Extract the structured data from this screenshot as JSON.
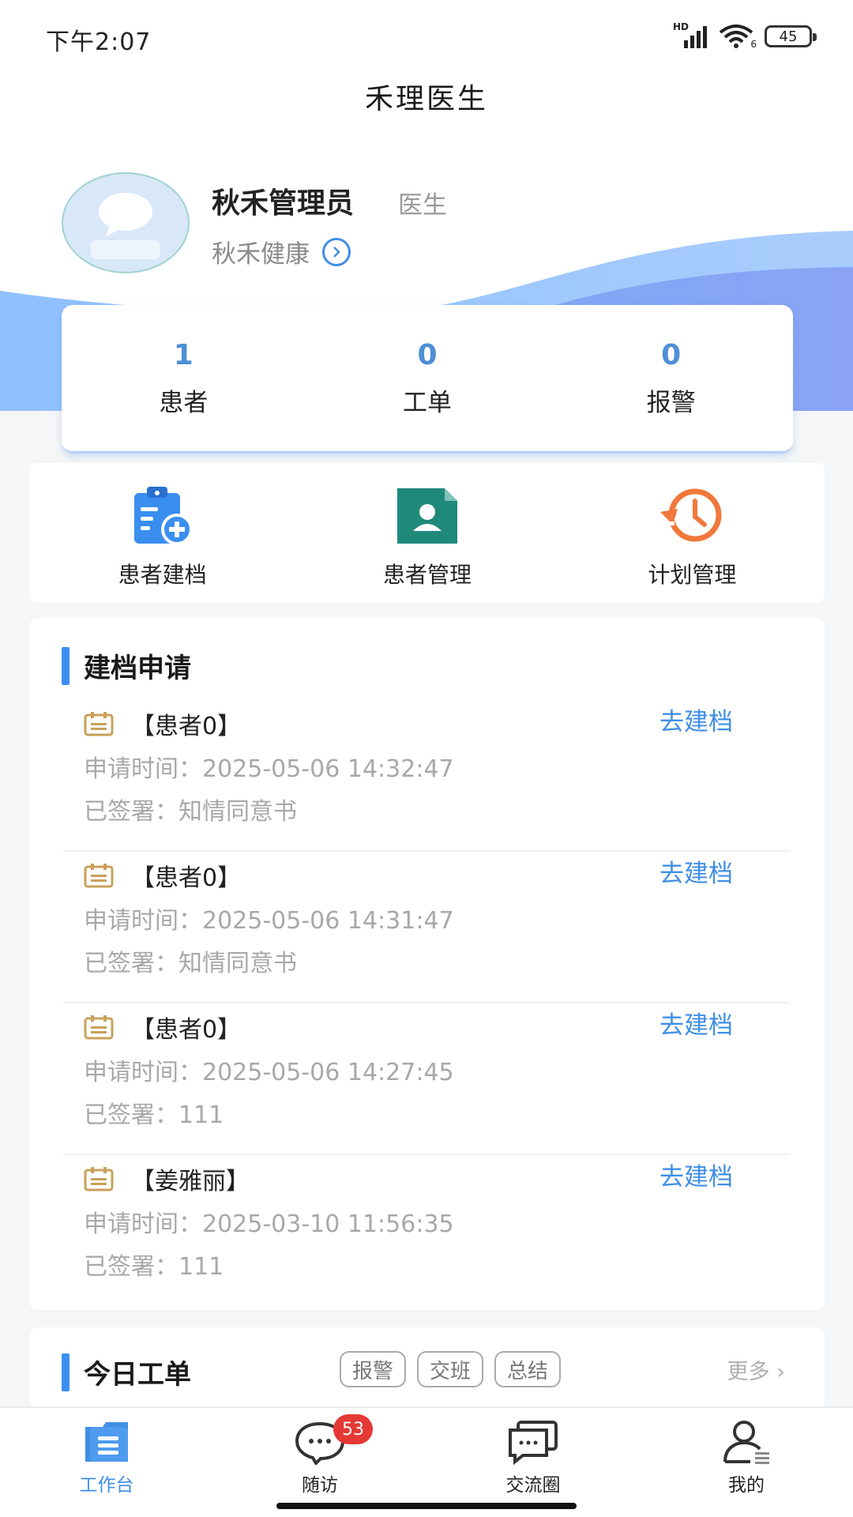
{
  "status_bar": {
    "time": "下午2:07",
    "network_label": "HD",
    "wifi_label": "6",
    "battery": "45"
  },
  "app": {
    "title": "禾理医生"
  },
  "profile": {
    "name": "秋禾管理员",
    "role": "医生",
    "organization": "秋禾健康"
  },
  "stats": [
    {
      "value": "1",
      "label": "患者"
    },
    {
      "value": "0",
      "label": "工单"
    },
    {
      "value": "0",
      "label": "报警"
    }
  ],
  "quick_menu": [
    {
      "label": "患者建档",
      "icon": "clipboard-add-icon",
      "color": "#3a8ef0"
    },
    {
      "label": "患者管理",
      "icon": "patient-file-icon",
      "color": "#1f8a7a"
    },
    {
      "label": "计划管理",
      "icon": "clock-history-icon",
      "color": "#f0783c"
    }
  ],
  "archive_section": {
    "title": "建档申请",
    "time_label": "申请时间：",
    "signed_label": "已签署：",
    "action_label": "去建档",
    "items": [
      {
        "name": "【患者0】",
        "time": "2025-05-06 14:32:47",
        "signed": "知情同意书"
      },
      {
        "name": "【患者0】",
        "time": "2025-05-06 14:31:47",
        "signed": "知情同意书"
      },
      {
        "name": "【患者0】",
        "time": "2025-05-06 14:27:45",
        "signed": "111"
      },
      {
        "name": "【姜雅丽】",
        "time": "2025-03-10 11:56:35",
        "signed": "111"
      }
    ]
  },
  "workorder_section": {
    "title": "今日工单",
    "tags": [
      "报警",
      "交班",
      "总结"
    ],
    "more_label": "更多"
  },
  "bottom_nav": [
    {
      "label": "工作台",
      "icon": "workbench-icon",
      "active": true
    },
    {
      "label": "随访",
      "icon": "chat-bubble-icon",
      "badge": "53"
    },
    {
      "label": "交流圈",
      "icon": "chat-stack-icon"
    },
    {
      "label": "我的",
      "icon": "user-icon"
    }
  ],
  "colors": {
    "accent": "#3f8fe6",
    "stat_value": "#4d8fd6",
    "badge": "#e53935",
    "calendar_icon": "#c9a15a"
  }
}
